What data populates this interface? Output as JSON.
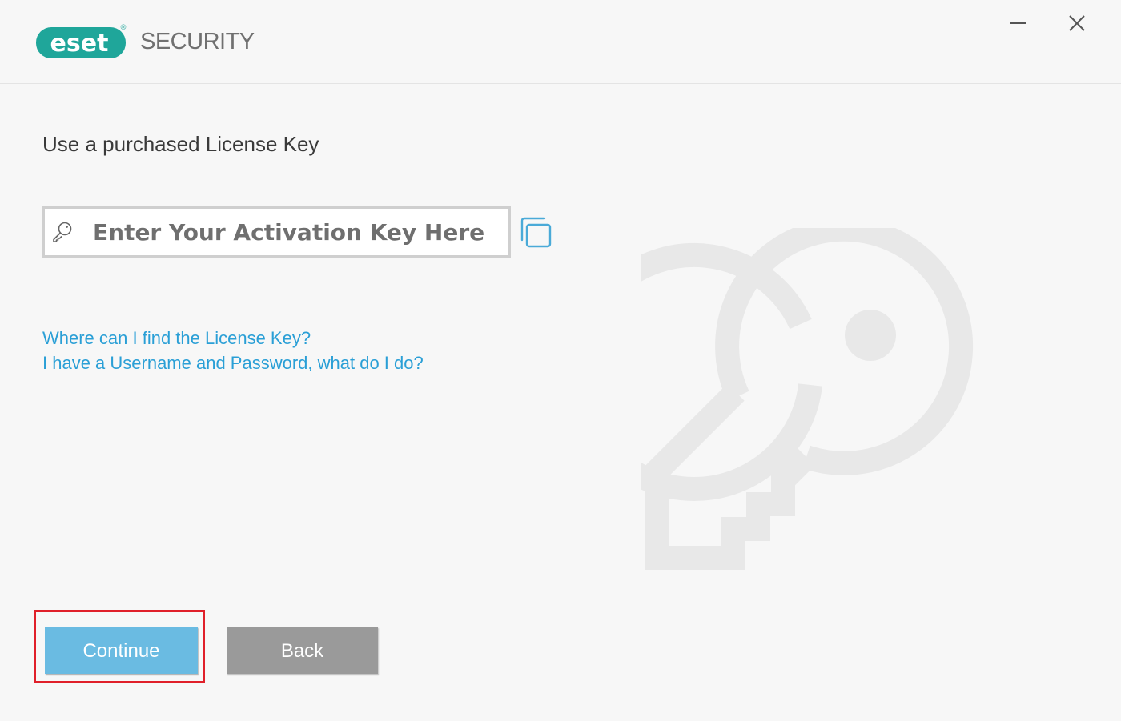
{
  "header": {
    "brand": "eset",
    "product": "SECURITY",
    "registered_mark": "®",
    "minimize_label": "Minimize",
    "close_label": "Close"
  },
  "main": {
    "heading": "Use a purchased License Key",
    "key_input": {
      "placeholder": "Enter Your Activation Key Here",
      "value": ""
    },
    "links": {
      "find_license": "Where can I find the License Key?",
      "username_password": "I have a Username and Password, what do I do?"
    }
  },
  "footer": {
    "continue_label": "Continue",
    "back_label": "Back"
  },
  "icons": {
    "key_field_icon": "key-icon",
    "paste_icon": "paste-icon",
    "background_illustration": "key-illustration"
  },
  "colors": {
    "brand_teal": "#1fa69a",
    "link_blue": "#2a9fd6",
    "continue_bg": "#6abbe2",
    "back_bg": "#9a9a9a",
    "highlight_red": "#e0202a"
  }
}
